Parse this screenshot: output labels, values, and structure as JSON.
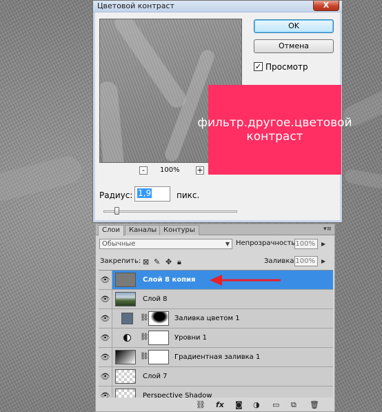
{
  "dialog": {
    "title": "Цветовой контраст",
    "close_label": "X",
    "ok_label": "OK",
    "cancel_label": "Отмена",
    "preview_checked": true,
    "preview_label": "Просмотр",
    "zoom_minus": "-",
    "zoom_plus": "+",
    "zoom_level": "100%",
    "radius_label": "Радиус:",
    "radius_value": "1,9",
    "radius_unit": "пикс."
  },
  "callout": {
    "text": "фильтр.другое.цветовой контраст",
    "color": "#ff2e63"
  },
  "layers_panel": {
    "tabs": [
      {
        "label": "Слои",
        "active": true
      },
      {
        "label": "Каналы",
        "active": false
      },
      {
        "label": "Контуры",
        "active": false
      }
    ],
    "blend_mode": "Обычные",
    "opacity_label": "Непрозрачность:",
    "opacity_value": "100%",
    "lock_label": "Закрепить:",
    "fill_label": "Заливка:",
    "fill_value": "100%",
    "layers": [
      {
        "name": "Слой 8 копия",
        "selected": true,
        "thumb": "gray",
        "mask": false
      },
      {
        "name": "Слой 8",
        "selected": false,
        "thumb": "photo",
        "mask": false
      },
      {
        "name": "Заливка цветом 1",
        "selected": false,
        "thumb": "color-fill",
        "mask": true
      },
      {
        "name": "Уровни 1",
        "selected": false,
        "thumb": "adjustment",
        "mask": true
      },
      {
        "name": "Градиентная заливка 1",
        "selected": false,
        "thumb": "gradient",
        "mask": true
      },
      {
        "name": "Слой 7",
        "selected": false,
        "thumb": "transparent",
        "mask": false
      },
      {
        "name": "Perspective Shadow",
        "selected": false,
        "thumb": "transparent",
        "mask": false
      }
    ],
    "selected_color": "#3a8de5"
  },
  "annotation": {
    "arrow_color": "#e8202a"
  }
}
